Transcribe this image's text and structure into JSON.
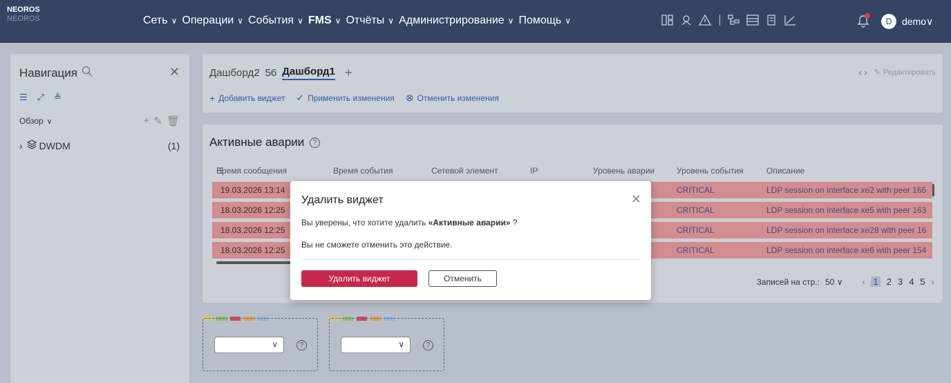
{
  "app": {
    "logo": "NEOROS",
    "logo_sub": "NEOROS"
  },
  "menu": [
    {
      "label": "Сеть",
      "bold": false
    },
    {
      "label": "Операции",
      "bold": false
    },
    {
      "label": "События",
      "bold": false
    },
    {
      "label": "FMS",
      "bold": true
    },
    {
      "label": "Отчёты",
      "bold": false
    },
    {
      "label": "Администрирование",
      "bold": false
    },
    {
      "label": "Помощь",
      "bold": false
    }
  ],
  "user": {
    "initial": "D",
    "name": "demo"
  },
  "sidebar": {
    "title": "Навигация",
    "overview": "Обзор",
    "tree": [
      {
        "label": "DWDM",
        "count": "(1)"
      }
    ]
  },
  "dashboard": {
    "tabs": [
      "Дашборд2",
      "56",
      "Дашборд1"
    ],
    "edit": "Редактировать",
    "actions": {
      "add": "Добавить виджет",
      "apply": "Применить изменения",
      "cancel": "Отменить изменения"
    }
  },
  "widget": {
    "title": "Активные аварии",
    "columns": [
      "Время сообщения",
      "Время события",
      "Сетевой элемент",
      "IP",
      "Уровень аварии",
      "Уровень события",
      "Описание"
    ],
    "rows": [
      {
        "time": "19.03.2026 13:14",
        "level": "CRITICAL",
        "desc": "LDP session on interface xe2 with peer 165"
      },
      {
        "time": "18.03.2026 12:25",
        "level": "CRITICAL",
        "desc": "LDP session on interface xe5 with peer 163"
      },
      {
        "time": "18.03.2026 12:25",
        "level": "CRITICAL",
        "desc": "LDP session on interface xe28 with peer 16"
      },
      {
        "time": "18.03.2026 12:25",
        "level": "CRITICAL",
        "desc": "LDP session on interface xe6 with peer 154"
      }
    ],
    "per_page_label": "Записей на стр.:",
    "per_page": "50",
    "pages": [
      "1",
      "2",
      "3",
      "4",
      "5"
    ]
  },
  "modal": {
    "title": "Удалить виджет",
    "q_prefix": "Вы уверены, что хотите удалить ",
    "q_name": "«Активные аварии»",
    "q_suffix": " ?",
    "warning": "Вы не сможете отменить это действие.",
    "delete": "Удалить виджет",
    "cancel": "Отменить"
  },
  "colors": {
    "topbar": "#334563",
    "accent": "#2a5fa8",
    "danger": "#c6284a",
    "row_alarm": "#d38c8f"
  }
}
